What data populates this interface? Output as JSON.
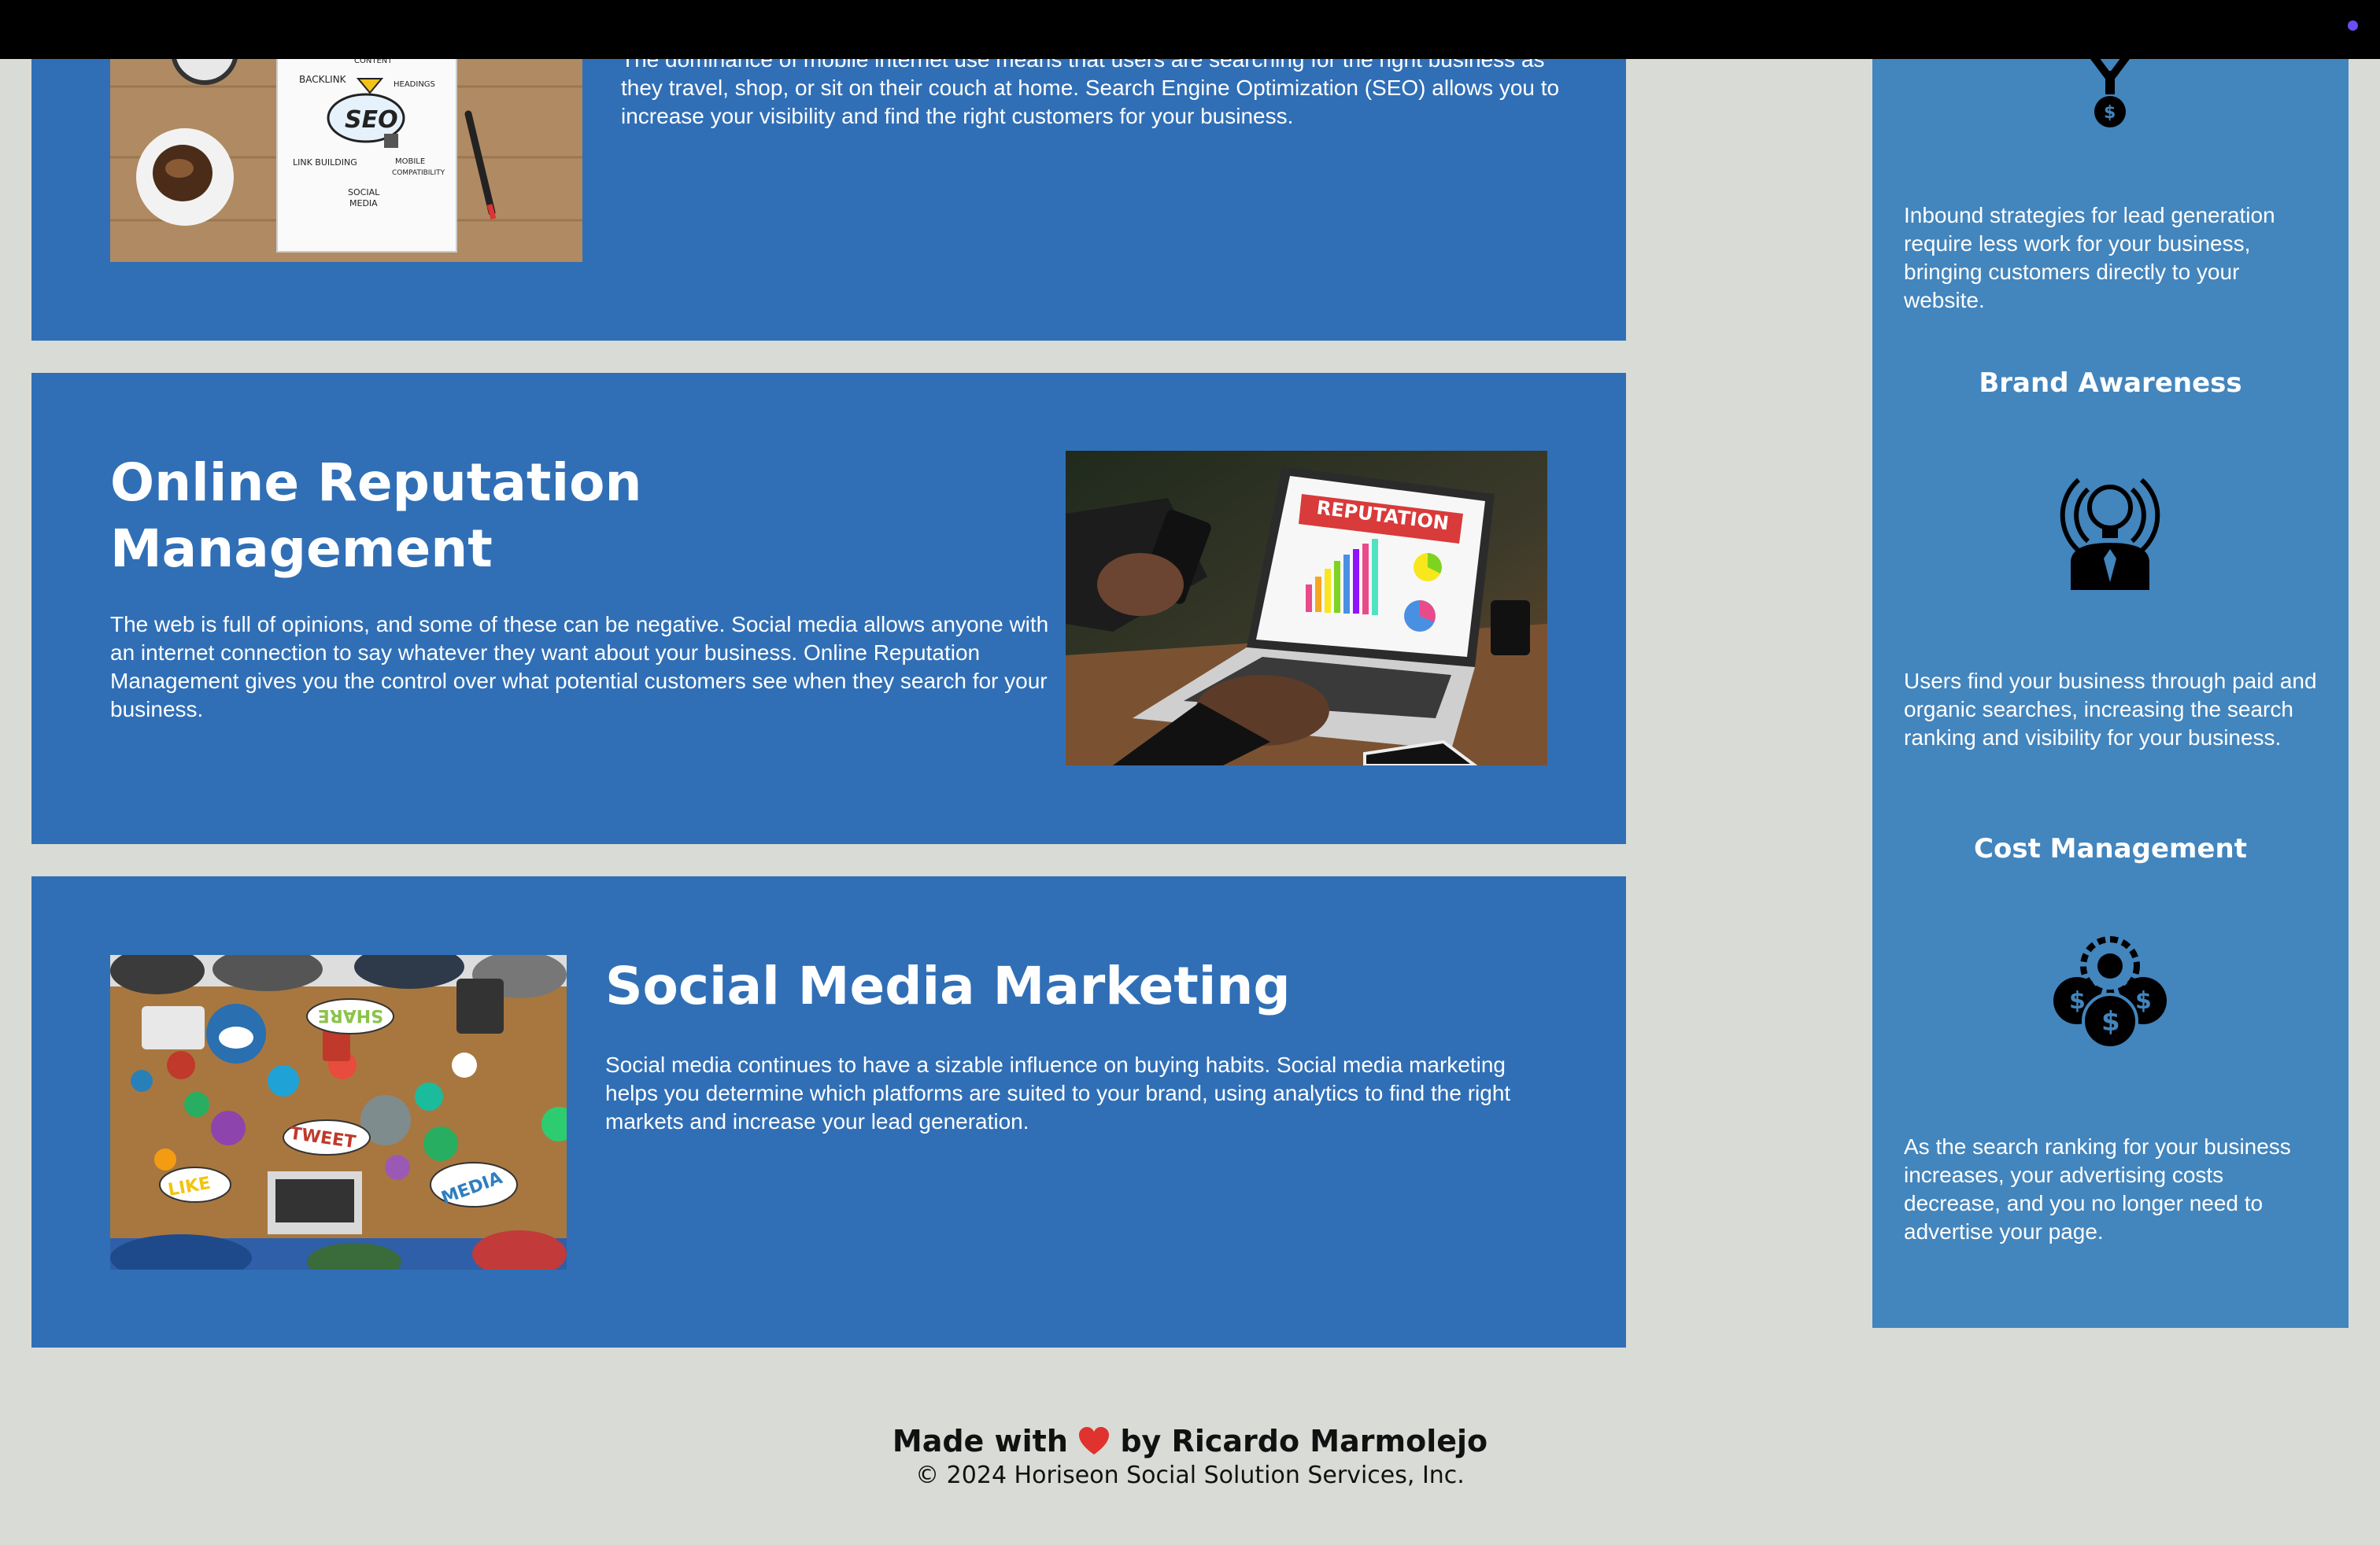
{
  "seo": {
    "text_partial_top": "The dominance of mobile internet use means that users are searching for the right",
    "text": "business as they travel, shop, or sit on their couch at home. Search Engine Optimization (SEO) allows you to increase your visibility and find the right customers for your business.",
    "image_words": {
      "seo": "SEO",
      "content": "CONTENT",
      "backlink": "BACKLINK",
      "headings": "HEADINGS",
      "link_building": "LINK BUILDING",
      "mobile": "MOBILE",
      "compatibility": "COMPATIBILITY",
      "social": "SOCIAL",
      "media": "MEDIA"
    }
  },
  "orm": {
    "title": "Online Reputation Management",
    "text": "The web is full of opinions, and some of these can be negative. Social media allows anyone with an internet connection to say whatever they want about your business. Online Reputation Management gives you the control over what potential customers see when they search for your business.",
    "image_word": "REPUTATION"
  },
  "smm": {
    "title": "Social Media Marketing",
    "text": "Social media continues to have a sizable influence on buying habits. Social media marketing helps you determine which platforms are suited to your brand, using analytics to find the right markets and increase your lead generation.",
    "image_words": {
      "share": "SHARE",
      "tweet": "TWEET",
      "like": "LIKE",
      "media": "MEDIA"
    }
  },
  "aside": {
    "lead_text": "Inbound strategies for lead generation require less work for your business, bringing customers directly to your website.",
    "brand_heading": "Brand Awareness",
    "brand_text": "Users find your business through paid and organic searches, increasing the search ranking and visibility for your business.",
    "cost_heading": "Cost Management",
    "cost_text": "As the search ranking for your business increases, your advertising costs decrease, and you no longer need to advertise your page.",
    "icons": [
      "lead-generation-icon",
      "brand-awareness-icon",
      "cost-management-icon"
    ]
  },
  "footer": {
    "made_with": "Made with",
    "by_author": "by Ricardo Marmolejo",
    "copyright": "© 2024 Horiseon Social Solution Services, Inc."
  },
  "colors": {
    "section_bg": "#306fb6",
    "aside_bg": "#4385bd",
    "page_bg": "#d9dbd6",
    "heart": "#e0322e"
  }
}
